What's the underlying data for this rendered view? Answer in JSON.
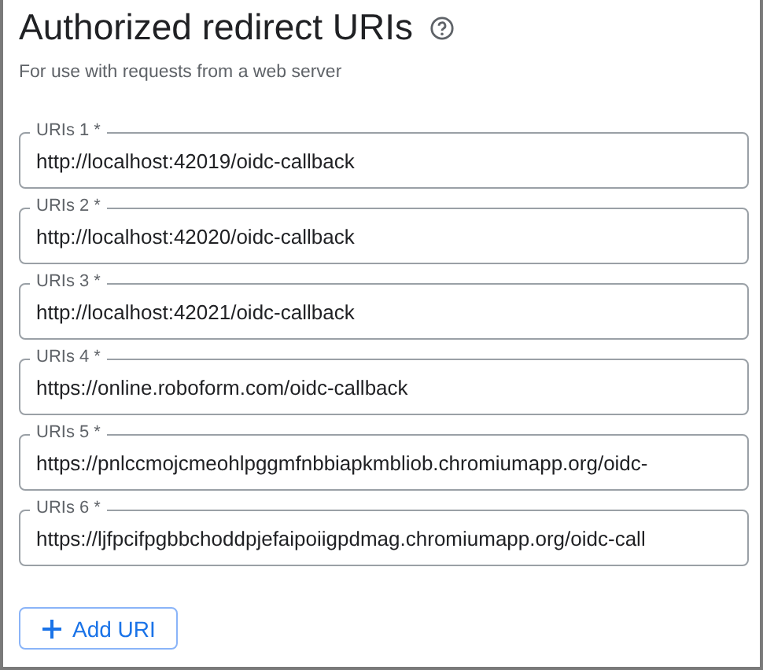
{
  "title": "Authorized redirect URIs",
  "subtitle": "For use with requests from a web server",
  "fields": [
    {
      "label": "URIs 1 *",
      "value": "http://localhost:42019/oidc-callback"
    },
    {
      "label": "URIs 2 *",
      "value": "http://localhost:42020/oidc-callback"
    },
    {
      "label": "URIs 3 *",
      "value": "http://localhost:42021/oidc-callback"
    },
    {
      "label": "URIs 4 *",
      "value": "https://online.roboform.com/oidc-callback"
    },
    {
      "label": "URIs 5 *",
      "value": "https://pnlccmojcmeohlpggmfnbbiapkmbliob.chromiumapp.org/oidc-"
    },
    {
      "label": "URIs 6 *",
      "value": "https://ljfpcifpgbbchoddpjefaipoiigpdmag.chromiumapp.org/oidc-call"
    }
  ],
  "add_button": "Add URI"
}
